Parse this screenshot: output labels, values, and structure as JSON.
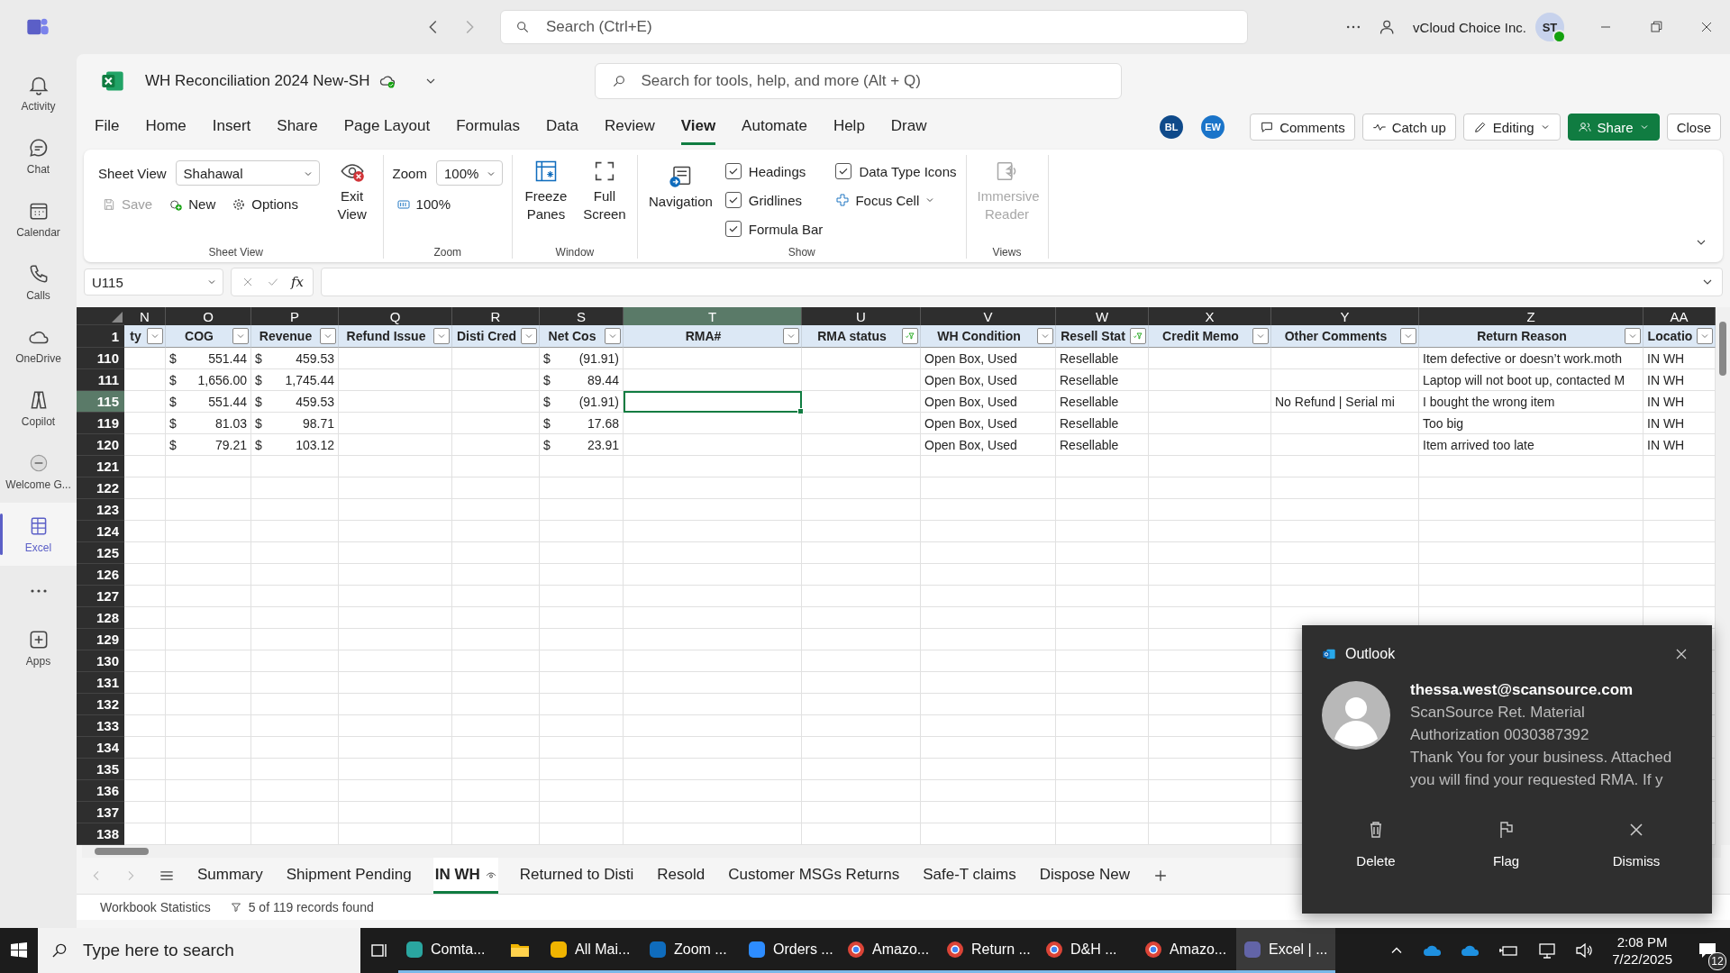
{
  "teams_bar": {
    "search_placeholder": "Search (Ctrl+E)",
    "org": "vCloud Choice Inc.",
    "avatar": "ST"
  },
  "rail": [
    {
      "label": "Activity",
      "selected": false
    },
    {
      "label": "Chat",
      "selected": false
    },
    {
      "label": "Calendar",
      "selected": false
    },
    {
      "label": "Calls",
      "selected": false
    },
    {
      "label": "OneDrive",
      "selected": false
    },
    {
      "label": "Copilot",
      "selected": false
    },
    {
      "label": "Welcome G...",
      "selected": false
    },
    {
      "label": "Excel",
      "selected": true
    },
    {
      "label": "Apps",
      "selected": false
    }
  ],
  "workbook": {
    "title": "WH Reconciliation 2024 New-SH",
    "tool_search_placeholder": "Search for tools, help, and more (Alt + Q)"
  },
  "menu": [
    {
      "label": "File",
      "selected": false
    },
    {
      "label": "Home",
      "selected": false
    },
    {
      "label": "Insert",
      "selected": false
    },
    {
      "label": "Share",
      "selected": false
    },
    {
      "label": "Page Layout",
      "selected": false
    },
    {
      "label": "Formulas",
      "selected": false
    },
    {
      "label": "Data",
      "selected": false
    },
    {
      "label": "Review",
      "selected": false
    },
    {
      "label": "View",
      "selected": true
    },
    {
      "label": "Automate",
      "selected": false
    },
    {
      "label": "Help",
      "selected": false
    },
    {
      "label": "Draw",
      "selected": false
    }
  ],
  "collaborators": [
    {
      "initials": "BL",
      "color": "#0f4a8a"
    },
    {
      "initials": "EW",
      "color": "#1a74c9"
    }
  ],
  "actions": [
    {
      "label": "Comments",
      "kind": "comments"
    },
    {
      "label": "Catch up",
      "kind": "catchup"
    },
    {
      "label": "Editing",
      "kind": "editing"
    },
    {
      "label": "Share",
      "kind": "share"
    },
    {
      "label": "Close",
      "kind": "close"
    }
  ],
  "ribbon": {
    "sheet_view": {
      "label": "Sheet View",
      "value": "Shahawal",
      "save": "Save",
      "save_disabled": true,
      "new": "New",
      "options": "Options",
      "exit": "Exit View",
      "group": "Sheet View"
    },
    "zoom": {
      "label": "Zoom",
      "value": "100%",
      "reset": "100%",
      "group": "Zoom"
    },
    "window": {
      "freeze": "Freeze Panes",
      "full": "Full Screen",
      "group": "Window"
    },
    "show": {
      "navigation": "Navigation",
      "checks": [
        {
          "label": "Headings",
          "checked": true
        },
        {
          "label": "Gridlines",
          "checked": true
        },
        {
          "label": "Formula Bar",
          "checked": true
        },
        {
          "label": "Data Type Icons",
          "checked": true
        }
      ],
      "focus_cell": "Focus Cell",
      "group": "Show"
    },
    "views": {
      "immersive": "Immersive Reader",
      "disabled": true,
      "group": "Views"
    }
  },
  "formula": {
    "name_box": "U115",
    "fn_label": "fx"
  },
  "grid": {
    "header_row": "1",
    "columns": [
      {
        "letter": "N",
        "label": "ty",
        "filtered": false,
        "selected": false
      },
      {
        "letter": "O",
        "label": "COG",
        "filtered": false,
        "selected": false
      },
      {
        "letter": "P",
        "label": "Revenue",
        "filtered": false,
        "selected": false
      },
      {
        "letter": "Q",
        "label": "Refund Issue",
        "filtered": false,
        "selected": false
      },
      {
        "letter": "R",
        "label": "Disti Cred",
        "filtered": false,
        "selected": false
      },
      {
        "letter": "S",
        "label": "Net Cos",
        "filtered": false,
        "selected": false
      },
      {
        "letter": "T",
        "label": "RMA#",
        "filtered": false,
        "selected": true
      },
      {
        "letter": "U",
        "label": "RMA status",
        "filtered": true,
        "selected": false
      },
      {
        "letter": "V",
        "label": "WH Condition",
        "filtered": false,
        "selected": false
      },
      {
        "letter": "W",
        "label": "Resell Stat",
        "filtered": true,
        "selected": false
      },
      {
        "letter": "X",
        "label": "Credit Memo",
        "filtered": false,
        "selected": false
      },
      {
        "letter": "Y",
        "label": "Other Comments",
        "filtered": false,
        "selected": false
      },
      {
        "letter": "Z",
        "label": "Return Reason",
        "filtered": false,
        "selected": false
      },
      {
        "letter": "AA",
        "label": "Locatio",
        "filtered": false,
        "selected": false
      }
    ],
    "rows": [
      {
        "num": "110",
        "selected": false,
        "cells": [
          null,
          {
            "symbol": "$",
            "amount": "551.44"
          },
          {
            "symbol": "$",
            "amount": "459.53"
          },
          null,
          null,
          {
            "symbol": "$",
            "amount": "(91.91)"
          },
          null,
          null,
          "Open Box, Used",
          "Resellable",
          null,
          null,
          "Item defective or doesn’t work.moth",
          "IN WH"
        ]
      },
      {
        "num": "111",
        "selected": false,
        "cells": [
          null,
          {
            "symbol": "$",
            "amount": "1,656.00"
          },
          {
            "symbol": "$",
            "amount": "1,745.44"
          },
          null,
          null,
          {
            "symbol": "$",
            "amount": "89.44"
          },
          null,
          null,
          "Open Box, Used",
          "Resellable",
          null,
          null,
          "Laptop will not boot up, contacted M",
          "IN WH"
        ]
      },
      {
        "num": "115",
        "selected": true,
        "cells": [
          null,
          {
            "symbol": "$",
            "amount": "551.44"
          },
          {
            "symbol": "$",
            "amount": "459.53"
          },
          null,
          null,
          {
            "symbol": "$",
            "amount": "(91.91)"
          },
          null,
          null,
          "Open Box, Used",
          "Resellable",
          null,
          "No Refund | Serial mi",
          "I bought the wrong item",
          "IN WH"
        ]
      },
      {
        "num": "119",
        "selected": false,
        "cells": [
          null,
          {
            "symbol": "$",
            "amount": "81.03"
          },
          {
            "symbol": "$",
            "amount": "98.71"
          },
          null,
          null,
          {
            "symbol": "$",
            "amount": "17.68"
          },
          null,
          null,
          "Open Box, Used",
          "Resellable",
          null,
          null,
          "Too big",
          "IN WH"
        ]
      },
      {
        "num": "120",
        "selected": false,
        "cells": [
          null,
          {
            "symbol": "$",
            "amount": "79.21"
          },
          {
            "symbol": "$",
            "amount": "103.12"
          },
          null,
          null,
          {
            "symbol": "$",
            "amount": "23.91"
          },
          null,
          null,
          "Open Box, Used",
          "Resellable",
          null,
          null,
          "Item arrived too late",
          "IN WH"
        ]
      }
    ],
    "empty_rows": [
      "121",
      "122",
      "123",
      "124",
      "125",
      "126",
      "127",
      "128",
      "129",
      "130",
      "131",
      "132",
      "133",
      "134",
      "135",
      "136",
      "137",
      "138"
    ]
  },
  "sheet_tabs": [
    {
      "label": "Summary",
      "selected": false
    },
    {
      "label": "Shipment Pending",
      "selected": false
    },
    {
      "label": "IN WH",
      "selected": true
    },
    {
      "label": "Returned to Disti",
      "selected": false
    },
    {
      "label": "Resold",
      "selected": false
    },
    {
      "label": "Customer MSGs Returns",
      "selected": false
    },
    {
      "label": "Safe-T claims",
      "selected": false
    },
    {
      "label": "Dispose New",
      "selected": false
    }
  ],
  "status_bar": {
    "stats": "Workbook Statistics",
    "records": "5 of 119 records found"
  },
  "notification": {
    "app": "Outlook",
    "sender": "thessa.west@scansource.com",
    "lines": [
      "ScanSource Ret. Material",
      "Authorization 0030387392",
      "Thank You for your business. Attached",
      "you will find your requested RMA.  If y"
    ],
    "actions": [
      "Delete",
      "Flag",
      "Dismiss"
    ]
  },
  "taskbar": {
    "search_placeholder": "Type here to search",
    "apps": [
      {
        "label": "Comta...",
        "selected": false
      },
      {
        "label": "All Mai...",
        "selected": false
      },
      {
        "label": "Zoom ...",
        "selected": false
      },
      {
        "label": "Orders ...",
        "selected": false
      },
      {
        "label": "Amazo...",
        "selected": false
      },
      {
        "label": "Return ...",
        "selected": false
      },
      {
        "label": "D&H ...",
        "selected": false
      },
      {
        "label": "Amazo...",
        "selected": false
      },
      {
        "label": "Excel | ...",
        "selected": true
      }
    ],
    "time": "2:08 PM",
    "date": "7/22/2025",
    "notif_count": "12"
  }
}
